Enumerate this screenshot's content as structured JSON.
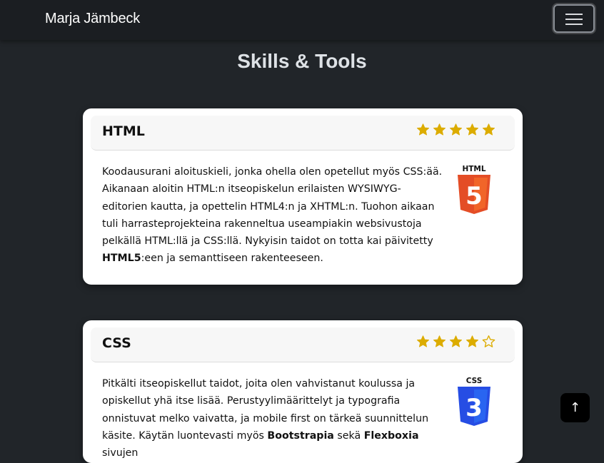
{
  "navbar": {
    "brand": "Marja Jämbeck",
    "toggler_icon": "hamburger-menu-icon"
  },
  "page": {
    "title": "Skills & Tools"
  },
  "colors": {
    "background": "#212529",
    "navbar": "#1b1e22",
    "star": "#dcac00",
    "html5_orange": "#e44d26",
    "css3_blue": "#264de4"
  },
  "skills": [
    {
      "title": "HTML",
      "rating": 5,
      "rating_max": 5,
      "logo_icon": "html5-logo-icon",
      "logo_label": "HTML",
      "logo_number": "5",
      "text_before": "Koodausurani aloituskieli, jonka ohella olen opetellut myös CSS:ää. Aikanaan aloitin HTML:n itseopiskelun erilaisten WYSIWYG-editorien kautta, ja opettelin HTML4:n ja XHTML:n. Tuohon aikaan tuli harrasteprojekteina rakenneltua useampiakin websivustoja pelkällä HTML:llä ja CSS:llä. Nykyisin taidot on totta kai päivitetty ",
      "text_bold": "HTML5",
      "text_after": ":een ja semanttiseen rakenteeseen."
    },
    {
      "title": "CSS",
      "rating": 4,
      "rating_max": 5,
      "logo_icon": "css3-logo-icon",
      "logo_label": "CSS",
      "logo_number": "3",
      "text_before": "Pitkälti itseopiskellut taidot, joita olen vahvistanut koulussa ja opiskellut yhä itse lisää. Perustyylimäärittelyt ja typografia onnistuvat melko vaivatta, ja mobile first on tärkeä suunnittelun käsite. Käytän luontevasti myös ",
      "text_bold": "Bootstrapia",
      "text_middle": " sekä ",
      "text_bold2": "Flexboxia",
      "text_after": " sivujen"
    }
  ],
  "back_to_top": {
    "label": "↑",
    "icon": "arrow-up-icon"
  }
}
